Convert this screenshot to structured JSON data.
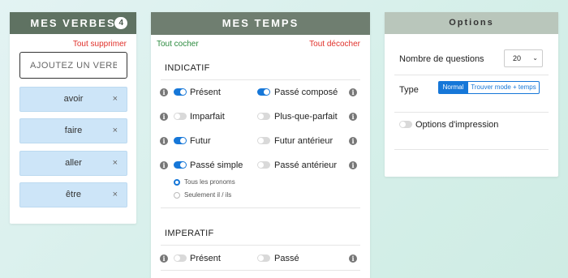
{
  "verbes": {
    "title": "MES VERBES",
    "count": "4",
    "clear_label": "Tout supprimer",
    "input_placeholder": "AJOUTEZ UN VERBE",
    "items": [
      {
        "label": "avoir",
        "remove": "×"
      },
      {
        "label": "faire",
        "remove": "×"
      },
      {
        "label": "aller",
        "remove": "×"
      },
      {
        "label": "être",
        "remove": "×"
      }
    ]
  },
  "temps": {
    "title": "MES TEMPS",
    "check_all": "Tout cocher",
    "uncheck_all": "Tout décocher",
    "indicatif": {
      "title": "INDICATIF",
      "tenses": [
        {
          "label": "Présent",
          "on": true
        },
        {
          "label": "Passé composé",
          "on": true
        },
        {
          "label": "Imparfait",
          "on": false
        },
        {
          "label": "Plus-que-parfait",
          "on": false
        },
        {
          "label": "Futur",
          "on": true
        },
        {
          "label": "Futur antérieur",
          "on": false
        },
        {
          "label": "Passé simple",
          "on": true
        },
        {
          "label": "Passé antérieur",
          "on": false
        }
      ],
      "pronoun_options": [
        {
          "label": "Tous les pronoms",
          "selected": true
        },
        {
          "label": "Seulement il / ils",
          "selected": false
        }
      ]
    },
    "imperatif": {
      "title": "IMPERATIF",
      "tenses": [
        {
          "label": "Présent",
          "on": false
        },
        {
          "label": "Passé",
          "on": false
        }
      ]
    },
    "info_glyph": "i"
  },
  "options": {
    "title": "Options",
    "questions_label": "Nombre de questions",
    "questions_value": "20",
    "type_label": "Type",
    "type_options": [
      "Normal",
      "Trouver mode + temps"
    ],
    "type_selected": "Normal",
    "print_label": "Options d'impression",
    "print_on": false
  },
  "colors": {
    "verbes_header": "#5f7262",
    "temps_header": "#6f7e70",
    "options_header": "#b9c6bb",
    "accent": "#1677d8",
    "chip": "#cde5f8",
    "danger": "#e0302a",
    "success": "#2b8a3e"
  }
}
